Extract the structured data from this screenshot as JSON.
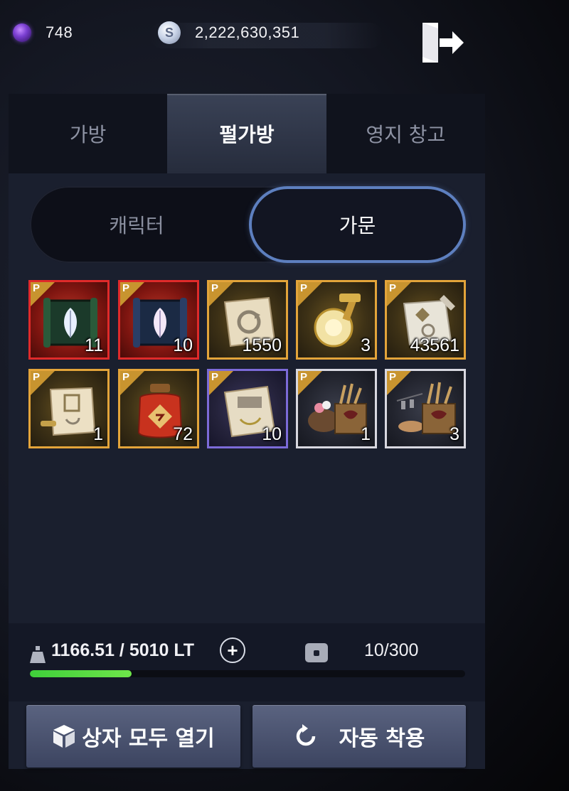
{
  "currency": {
    "gem_icon": "purple-gem-icon",
    "gem_amount": "748",
    "silver_icon": "silver-coin-icon",
    "silver_symbol": "S",
    "silver_amount": "2,222,630,351"
  },
  "exit_icon": "exit-door-icon",
  "tabs": [
    {
      "label": "가방",
      "active": false
    },
    {
      "label": "펄가방",
      "active": true
    },
    {
      "label": "영지 창고",
      "active": false
    }
  ],
  "segment": {
    "character_label": "캐릭터",
    "family_label": "가문",
    "selected": "가문"
  },
  "items": [
    {
      "grade": "red",
      "premium_tag": "P",
      "icon": "green-feather-scroll-icon",
      "qty": "11"
    },
    {
      "grade": "red",
      "premium_tag": "P",
      "icon": "blue-feather-scroll-icon",
      "qty": "10"
    },
    {
      "grade": "gold",
      "premium_tag": "P",
      "icon": "refresh-scroll-icon",
      "qty": "1550"
    },
    {
      "grade": "gold",
      "premium_tag": "P",
      "icon": "golden-orb-hammer-icon",
      "qty": "3"
    },
    {
      "grade": "gold",
      "premium_tag": "P",
      "icon": "quill-scroll-icon",
      "qty": "43561"
    },
    {
      "grade": "gold",
      "premium_tag": "P",
      "icon": "blueprint-scroll-icon",
      "qty": "1"
    },
    {
      "grade": "gold",
      "premium_tag": "P",
      "icon": "red-potion-jar-icon",
      "qty": "72"
    },
    {
      "grade": "purple",
      "premium_tag": "P",
      "icon": "map-scroll-icon",
      "qty": "10"
    },
    {
      "grade": "white",
      "premium_tag": "P",
      "icon": "flower-crate-icon",
      "qty": "1"
    },
    {
      "grade": "white",
      "premium_tag": "P",
      "icon": "tool-crate-icon",
      "qty": "3"
    }
  ],
  "status": {
    "weight_icon": "weight-icon",
    "weight_text": "1166.51 / 5010 LT",
    "weight_progress": 0.233,
    "plus_label": "+",
    "bag_icon": "bag-slot-icon",
    "slots_text": "10/300",
    "colors": {
      "progress": "#4fd63f",
      "accent": "#5d7fbf",
      "tier_red": "#e02a2a",
      "tier_gold": "#e3a43a",
      "tier_purple": "#7c6bd8",
      "tier_white": "#d8d8e0"
    }
  },
  "actions": {
    "open_all_label": "상자 모두 열기",
    "open_all_icon": "box-icon",
    "auto_equip_label": "자동 착용",
    "auto_equip_icon": "refresh-icon"
  }
}
